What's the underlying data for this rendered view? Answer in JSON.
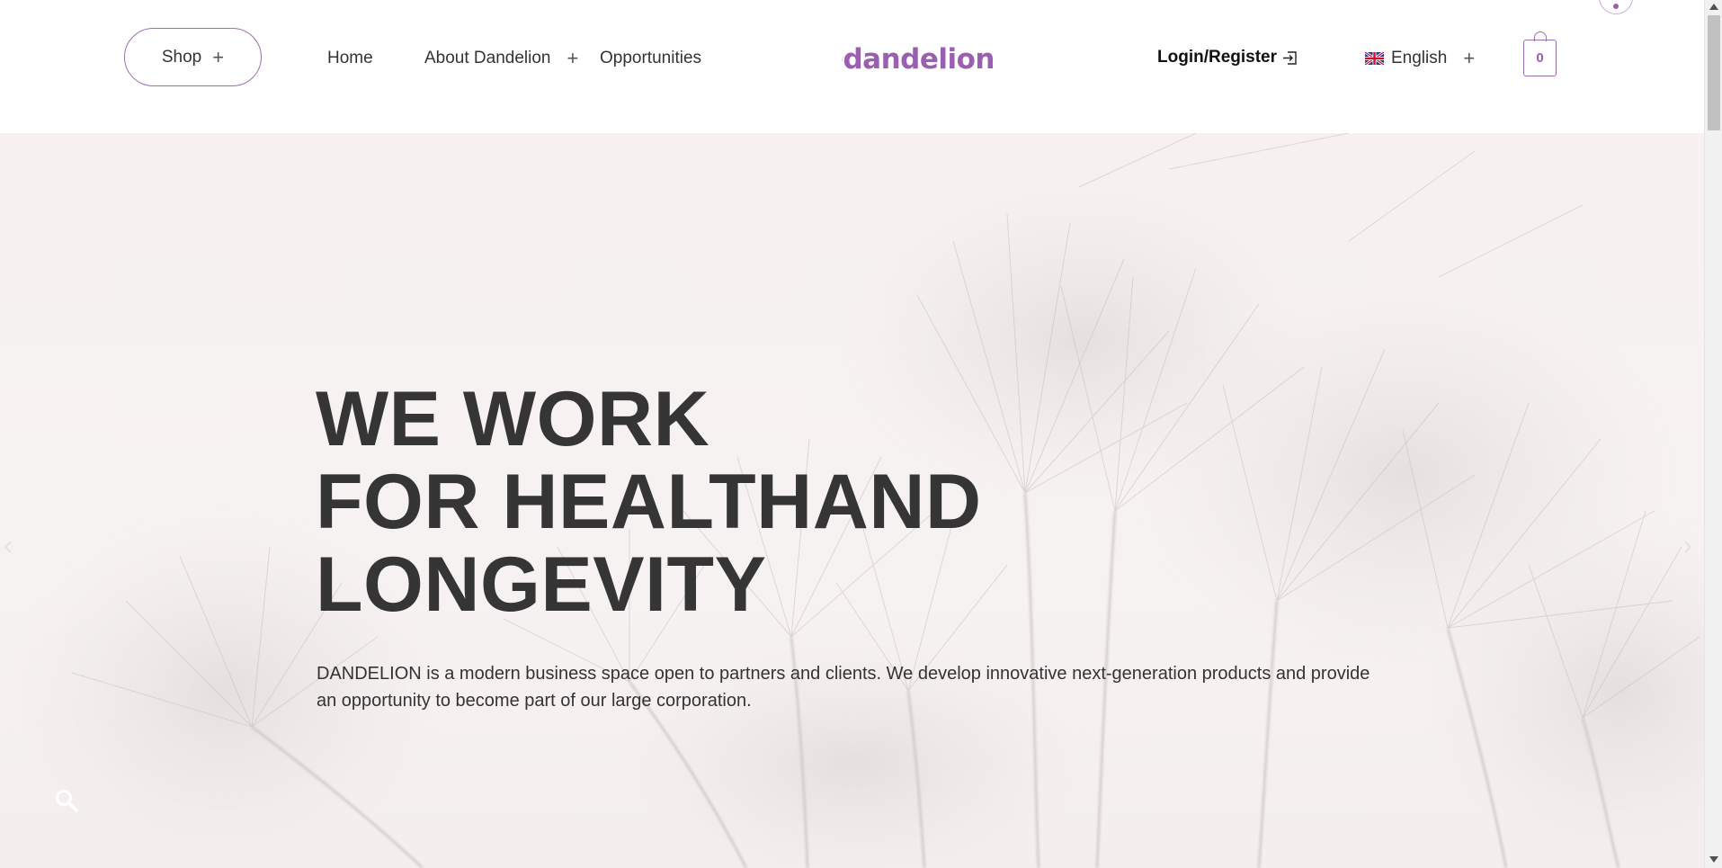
{
  "header": {
    "shop_label": "Shop",
    "nav": {
      "home": "Home",
      "about": "About Dandelion",
      "opportunities": "Opportunities"
    },
    "logo_text": "dandelion",
    "login_label": "Login/Register",
    "language_label": "English",
    "cart_count": "0",
    "icons": {
      "shop_expand": "plus-icon",
      "about_expand": "plus-icon",
      "login": "login-arrow-icon",
      "language_flag": "uk-flag-icon",
      "language_expand": "plus-icon",
      "cart": "shopping-bag-icon"
    }
  },
  "hero": {
    "title_lines": [
      "WE WORK",
      "FOR HEALTHAND",
      "LONGEVITY"
    ],
    "description": "DANDELION is a modern business space open to partners and clients. We develop innovative next-generation products and provide an opportunity to become part of our large corporation.",
    "icons": {
      "prev": "chevron-left-icon",
      "next": "chevron-right-icon",
      "search": "search-icon"
    }
  },
  "colors": {
    "brand": "#9a5fb0",
    "outline": "#9a6fae",
    "heading": "#353535",
    "hero_background": "#f6f1f0"
  }
}
